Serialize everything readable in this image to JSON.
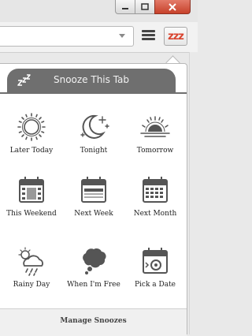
{
  "header": {
    "title": "Snooze This Tab",
    "zzz": "zzz"
  },
  "toolbar": {
    "snooze_button_label": "zzz"
  },
  "options": [
    {
      "label": "Later Today",
      "icon": "sun-icon"
    },
    {
      "label": "Tonight",
      "icon": "moon-stars-icon"
    },
    {
      "label": "Tomorrow",
      "icon": "sunrise-icon"
    },
    {
      "label": "This Weekend",
      "icon": "calendar-weekend-icon"
    },
    {
      "label": "Next Week",
      "icon": "calendar-week-icon"
    },
    {
      "label": "Next Month",
      "icon": "calendar-month-icon"
    },
    {
      "label": "Rainy Day",
      "icon": "rain-cloud-icon"
    },
    {
      "label": "When I'm Free",
      "icon": "thought-cloud-icon"
    },
    {
      "label": "Pick a Date",
      "icon": "calendar-pick-icon"
    }
  ],
  "footer": {
    "manage_label": "Manage Snoozes"
  },
  "colors": {
    "accent": "#d9432e",
    "header": "#6f6f6f",
    "icon": "#555555"
  }
}
